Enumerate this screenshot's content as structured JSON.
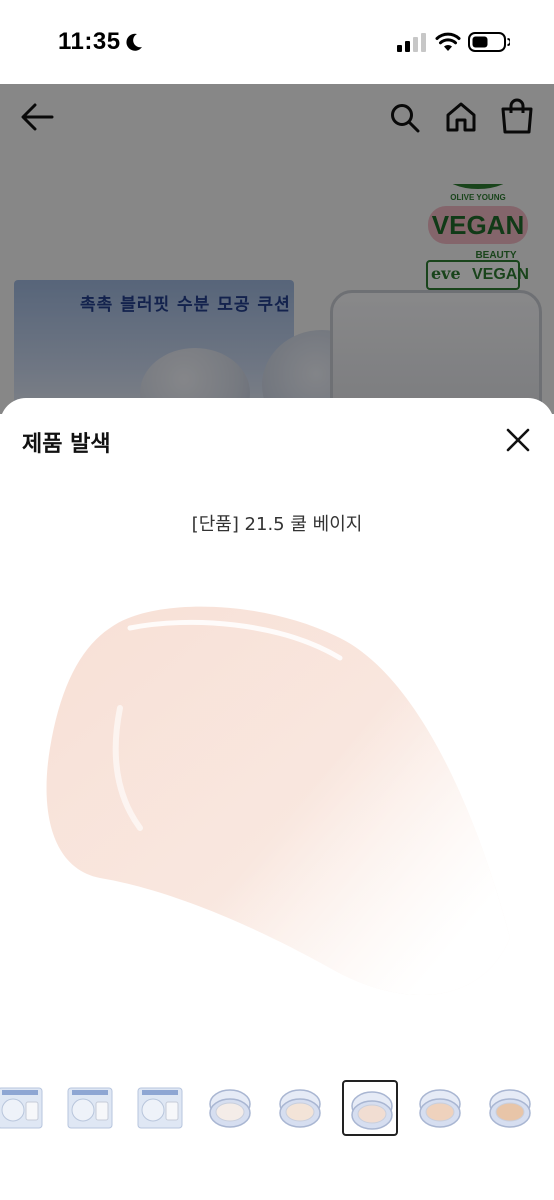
{
  "status_bar": {
    "time": "11:35",
    "icons": [
      "moon-icon",
      "signal-icon",
      "wifi-icon",
      "battery-icon"
    ]
  },
  "background_page": {
    "header_icons": [
      "back-icon",
      "search-icon",
      "home-icon",
      "cart-icon"
    ],
    "badge_olive_young": "OLIVE YOUNG",
    "badge_vegan": "VEGAN",
    "badge_beauty": "BEAUTY",
    "eve_logo": "eve",
    "eve_vegan": "VEGAN",
    "product_box_title": "촉촉 블러핏 수분 모공 쿠션"
  },
  "sheet": {
    "title": "제품 발색",
    "shade_name": "[단품] 21.5 쿨 베이지",
    "swatch_color": "#f7e2da",
    "thumbnails": [
      {
        "kind": "box"
      },
      {
        "kind": "box"
      },
      {
        "kind": "box"
      },
      {
        "kind": "compact",
        "puff": "#f4ece8"
      },
      {
        "kind": "compact",
        "puff": "#f3e4d8"
      },
      {
        "kind": "compact",
        "puff": "#f1ddd2",
        "selected": true
      },
      {
        "kind": "compact",
        "puff": "#efd2bd"
      },
      {
        "kind": "compact",
        "puff": "#e8c5a8"
      }
    ]
  }
}
